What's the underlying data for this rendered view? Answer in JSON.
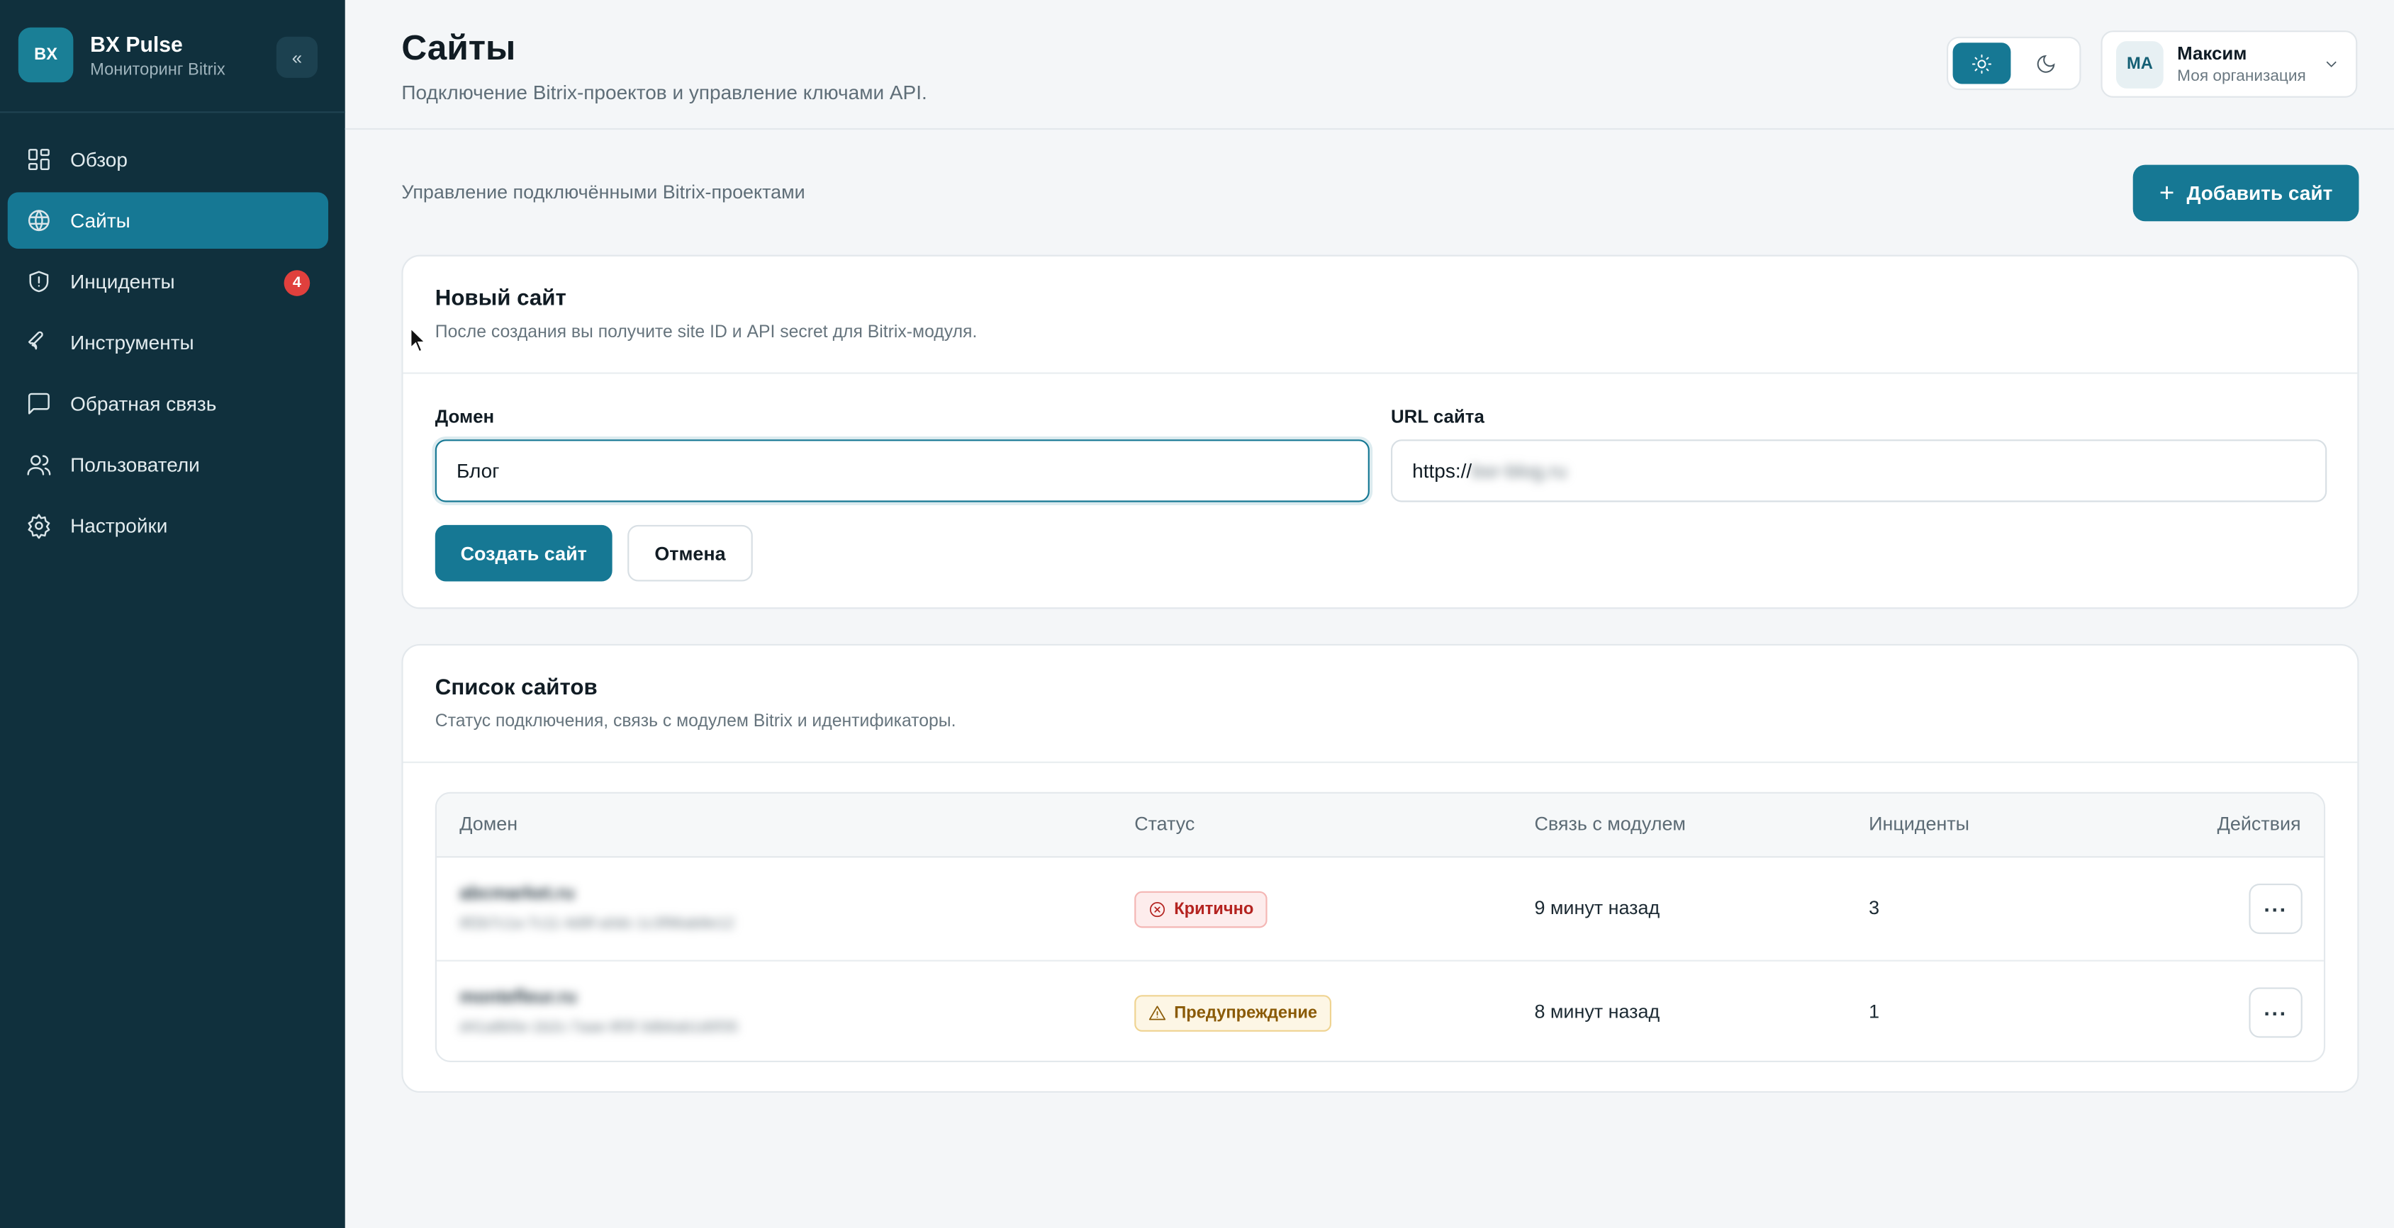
{
  "app": {
    "logo_text": "BX",
    "title": "BX Pulse",
    "subtitle": "Мониторинг Bitrix",
    "collapse_glyph": "«"
  },
  "sidebar": {
    "items": [
      {
        "label": "Обзор",
        "icon": "dashboard-icon",
        "active": false
      },
      {
        "label": "Сайты",
        "icon": "globe-icon",
        "active": true
      },
      {
        "label": "Инциденты",
        "icon": "shield-alert-icon",
        "active": false,
        "badge": "4"
      },
      {
        "label": "Инструменты",
        "icon": "wrench-icon",
        "active": false
      },
      {
        "label": "Обратная связь",
        "icon": "message-icon",
        "active": false
      },
      {
        "label": "Пользователи",
        "icon": "users-icon",
        "active": false
      },
      {
        "label": "Настройки",
        "icon": "gear-icon",
        "active": false
      }
    ]
  },
  "header": {
    "title": "Сайты",
    "subtitle": "Подключение Bitrix-проектов и управление ключами API.",
    "theme": {
      "active": "light"
    },
    "user": {
      "initials": "МА",
      "name": "Максим",
      "org": "Моя организация"
    }
  },
  "main": {
    "caption": "Управление подключёнными Bitrix-проектами",
    "add_button": "Добавить сайт",
    "new_site": {
      "title": "Новый сайт",
      "description": "После создания вы получите site ID и API secret для Bitrix-модуля.",
      "domain_label": "Домен",
      "domain_value": "Блог",
      "url_label": "URL сайта",
      "url_prefix": "https://",
      "url_hidden": "bsr-blog.ru",
      "create_button": "Создать сайт",
      "cancel_button": "Отмена"
    },
    "site_list": {
      "title": "Список сайтов",
      "description": "Статус подключения, связь с модулем Bitrix и идентификаторы.",
      "columns": [
        "Домен",
        "Статус",
        "Связь с модулем",
        "Инциденты",
        "Действия"
      ],
      "rows": [
        {
          "domain": "abcmarket.ru",
          "site_id": "8f2b7c1a-7c11-4d9f-a0dc-1c3f96ab8e12",
          "status": "Критично",
          "status_kind": "critical",
          "last_seen": "9 минут назад",
          "incidents": "3"
        },
        {
          "domain": "montefleur.ru",
          "site_id": "d41a8b5e-1b2c-7aae-9f3f-3db6ab1d0f35",
          "status": "Предупреждение",
          "status_kind": "warning",
          "last_seen": "8 минут назад",
          "incidents": "1"
        }
      ]
    }
  },
  "colors": {
    "sidebar": "#10303d",
    "accent": "#167894",
    "critical": "#b42320",
    "warning": "#8a5a06",
    "badge": "#e0403d"
  }
}
